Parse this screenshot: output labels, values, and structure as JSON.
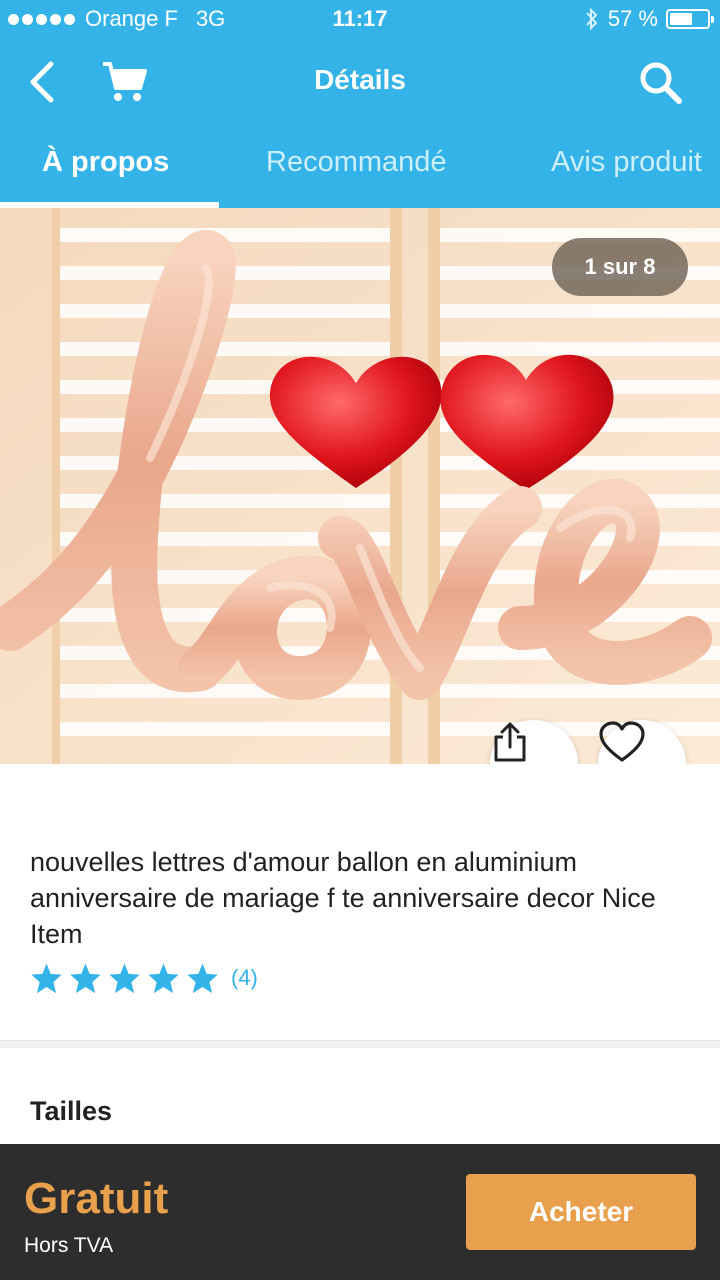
{
  "status_bar": {
    "carrier": "Orange F",
    "network": "3G",
    "time": "11:17",
    "battery": "57 %",
    "battery_level": 0.57
  },
  "nav": {
    "title": "Détails",
    "icons": [
      "back-icon",
      "cart-icon",
      "search-icon"
    ]
  },
  "tabs": [
    {
      "label": "À propos",
      "active": true
    },
    {
      "label": "Recommandé",
      "active": false
    },
    {
      "label": "Avis produit",
      "active": false
    }
  ],
  "gallery": {
    "counter": "1 sur 8",
    "image_text": "love"
  },
  "product": {
    "title": "nouvelles lettres d'amour ballon en aluminium anniversaire de mariage f te anniversaire decor Nice Item",
    "rating": 5,
    "reviews": "(4)"
  },
  "sections": {
    "sizes_title": "Tailles"
  },
  "footer": {
    "price": "Gratuit",
    "price_note": "Hors TVA",
    "buy_label": "Acheter"
  },
  "colors": {
    "brand": "#34b3e8",
    "accent": "#e8a04c",
    "footer_bg": "#2d2d2d"
  }
}
